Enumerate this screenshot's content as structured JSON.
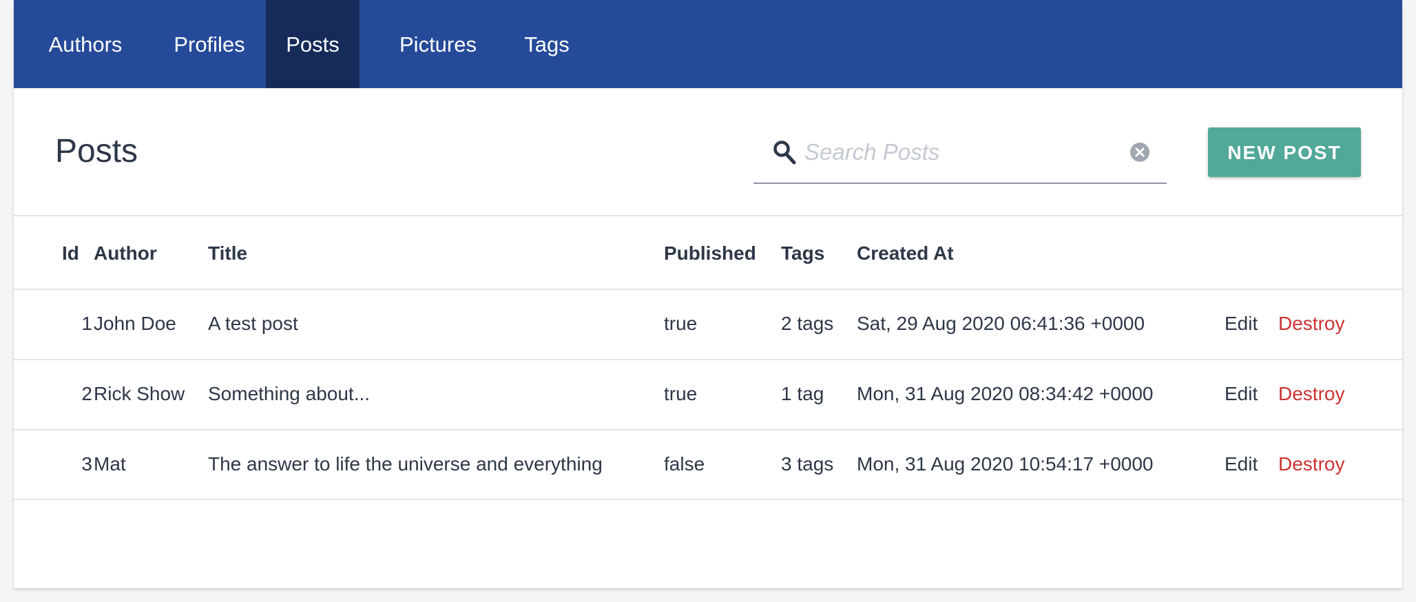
{
  "nav": {
    "items": [
      {
        "label": "Authors"
      },
      {
        "label": "Profiles"
      },
      {
        "label": "Posts",
        "active": true
      },
      {
        "label": "Pictures"
      },
      {
        "label": "Tags"
      }
    ]
  },
  "header": {
    "title": "Posts",
    "search": {
      "placeholder": "Search Posts",
      "value": ""
    },
    "new_button_label": "NEW POST"
  },
  "table": {
    "columns": [
      "Id",
      "Author",
      "Title",
      "Published",
      "Tags",
      "Created At"
    ],
    "rows": [
      {
        "id": "1",
        "author": "John Doe",
        "title": "A test post",
        "published": "true",
        "tags": "2 tags",
        "created_at": "Sat, 29 Aug 2020 06:41:36 +0000",
        "edit": "Edit",
        "destroy": "Destroy"
      },
      {
        "id": "2",
        "author": "Rick Show",
        "title": "Something about...",
        "published": "true",
        "tags": "1 tag",
        "created_at": "Mon, 31 Aug 2020 08:34:42 +0000",
        "edit": "Edit",
        "destroy": "Destroy"
      },
      {
        "id": "3",
        "author": "Mat",
        "title": "The answer to life the universe and everything",
        "published": "false",
        "tags": "3 tags",
        "created_at": "Mon, 31 Aug 2020 10:54:17 +0000",
        "edit": "Edit",
        "destroy": "Destroy"
      }
    ]
  },
  "colors": {
    "nav_background": "#254a99",
    "nav_active": "#162b5a",
    "button_background": "#52a899",
    "destroy_link": "#cc3333",
    "text": "#2d3748"
  },
  "icons": {
    "search": "search-icon",
    "clear": "clear-icon"
  }
}
